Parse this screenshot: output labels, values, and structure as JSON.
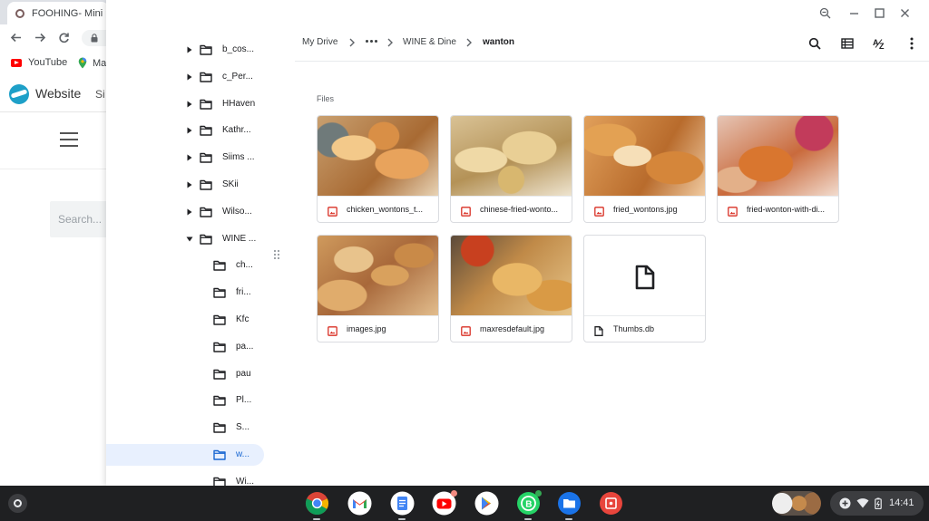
{
  "browser": {
    "tab_title": "FOOHING- Mini pa",
    "bookmarks": [
      {
        "label": "YouTube",
        "icon": "youtube-icon"
      },
      {
        "label": "Ma",
        "icon": "maps-icon"
      }
    ],
    "site": {
      "name": "Website",
      "nav_partial": "Si",
      "search_placeholder": "Search..."
    }
  },
  "files": {
    "sidebar": [
      {
        "label": "b_cos...",
        "expanded": false,
        "level": 0
      },
      {
        "label": "c_Per...",
        "expanded": false,
        "level": 0
      },
      {
        "label": "HHaven",
        "expanded": false,
        "level": 0
      },
      {
        "label": "Kathr...",
        "expanded": false,
        "level": 0
      },
      {
        "label": "Siims ...",
        "expanded": false,
        "level": 0
      },
      {
        "label": "SKii",
        "expanded": false,
        "level": 0
      },
      {
        "label": "Wilso...",
        "expanded": false,
        "level": 0
      },
      {
        "label": "WINE ...",
        "expanded": true,
        "level": 0
      },
      {
        "label": "ch...",
        "level": 1
      },
      {
        "label": "fri...",
        "level": 1
      },
      {
        "label": "Kfc",
        "level": 1
      },
      {
        "label": "pa...",
        "level": 1
      },
      {
        "label": "pau",
        "level": 1
      },
      {
        "label": "Pl...",
        "level": 1
      },
      {
        "label": "S...",
        "level": 1
      },
      {
        "label": "w...",
        "level": 1,
        "selected": true
      },
      {
        "label": "Wi...",
        "level": 1
      }
    ],
    "breadcrumb": {
      "root": "My Drive",
      "parent": "WINE & Dine",
      "current": "wanton"
    },
    "section_label": "Files",
    "items": [
      {
        "name": "chicken_wontons_t...",
        "type": "image",
        "thumb": "food1"
      },
      {
        "name": "chinese-fried-wonto...",
        "type": "image",
        "thumb": "food2"
      },
      {
        "name": "fried_wontons.jpg",
        "type": "image",
        "thumb": "food3"
      },
      {
        "name": "fried-wonton-with-di...",
        "type": "image",
        "thumb": "food4"
      },
      {
        "name": "images.jpg",
        "type": "image",
        "thumb": "food5"
      },
      {
        "name": "maxresdefault.jpg",
        "type": "image",
        "thumb": "food6"
      },
      {
        "name": "Thumbs.db",
        "type": "file"
      }
    ],
    "colors": {
      "accent": "#1967d2",
      "selected_bg": "#e8f0fe",
      "image_icon": "#d93025"
    }
  },
  "shelf": {
    "apps": [
      {
        "name": "chrome-icon",
        "active": true
      },
      {
        "name": "gmail-icon",
        "active": false
      },
      {
        "name": "docs-icon",
        "active": true
      },
      {
        "name": "youtube-icon",
        "active": false,
        "badge": true
      },
      {
        "name": "play-store-icon",
        "active": false
      },
      {
        "name": "whatsapp-business-icon",
        "active": true,
        "badge": true
      },
      {
        "name": "files-icon",
        "active": true
      },
      {
        "name": "screencast-icon",
        "active": false
      }
    ],
    "time": "14:41"
  }
}
